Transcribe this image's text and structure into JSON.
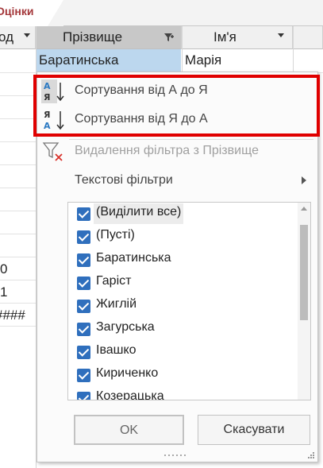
{
  "tab": {
    "label": "Оцінки"
  },
  "headers": [
    {
      "label": "од"
    },
    {
      "label": "Прізвище"
    },
    {
      "label": "Ім'я"
    }
  ],
  "current_row": {
    "surname": "Баратинська",
    "first_name": "Марія"
  },
  "left_column_values": [
    "0",
    "1",
    "####"
  ],
  "popup": {
    "sort_asc": "Сортування від А до Я",
    "sort_desc": "Сортування від Я до А",
    "clear_filter": "Видалення фільтра з Прізвище",
    "text_filters": "Текстові фільтри",
    "checklist": [
      "(Виділити все)",
      "(Пусті)",
      "Баратинська",
      "Гаріст",
      "Жиглій",
      "Загурська",
      "Івашко",
      "Кириченко",
      "Козерацька"
    ],
    "ok_label": "OK",
    "cancel_label": "Скасувати"
  },
  "highlight_color": "#e00000",
  "checkbox_color": "#2f6fbd"
}
